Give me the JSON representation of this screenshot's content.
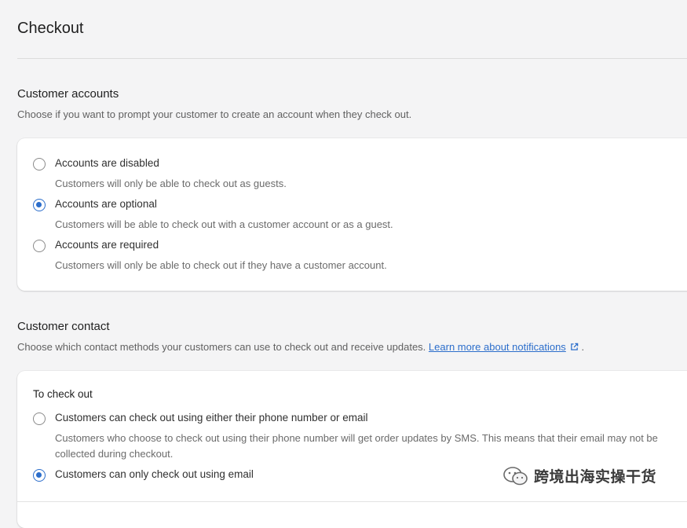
{
  "page": {
    "title": "Checkout"
  },
  "customer_accounts": {
    "title": "Customer accounts",
    "description": "Choose if you want to prompt your customer to create an account when they check out.",
    "options": [
      {
        "label": "Accounts are disabled",
        "help": "Customers will only be able to check out as guests.",
        "selected": false
      },
      {
        "label": "Accounts are optional",
        "help": "Customers will be able to check out with a customer account or as a guest.",
        "selected": true
      },
      {
        "label": "Accounts are required",
        "help": "Customers will only be able to check out if they have a customer account.",
        "selected": false
      }
    ]
  },
  "customer_contact": {
    "title": "Customer contact",
    "description": "Choose which contact methods your customers can use to check out and receive updates.",
    "link_text": "Learn more about notifications",
    "link_icon": "external-link-icon",
    "trailing": ".",
    "subheading": "To check out",
    "options": [
      {
        "label": "Customers can check out using either their phone number or email",
        "help": "Customers who choose to check out using their phone number will get order updates by SMS. This means that their email may not be collected during checkout.",
        "selected": false
      },
      {
        "label": "Customers can only check out using email",
        "help": "",
        "selected": true
      }
    ]
  },
  "watermark": {
    "text": "跨境出海实操干货",
    "icon": "wechat-icon"
  },
  "colors": {
    "accent": "#2c6ecb",
    "background": "#f4f4f5",
    "card": "#ffffff"
  }
}
